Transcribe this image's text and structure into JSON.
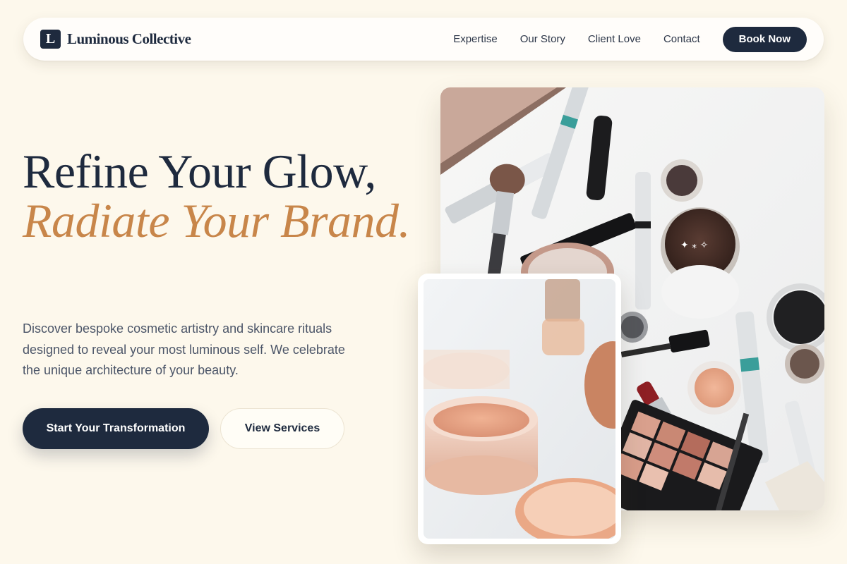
{
  "brand": {
    "mark": "L",
    "name": "Luminous Collective"
  },
  "nav": {
    "links": [
      "Expertise",
      "Our Story",
      "Client Love",
      "Contact"
    ],
    "cta": "Book Now"
  },
  "hero": {
    "headline_line1": "Refine Your Glow,",
    "headline_accent": "Radiate Your Brand.",
    "description": "Discover bespoke cosmetic artistry and skincare rituals designed to reveal your most luminous self. We celebrate the unique architecture of your beauty.",
    "primary_cta": "Start Your Transformation",
    "secondary_cta": "View Services"
  },
  "colors": {
    "page_bg": "#fdf8ec",
    "navy": "#1e2a3e",
    "accent": "#c8864a"
  },
  "images": {
    "main": "flat-lay of makeup products: brushes, mascara, lipstick, eyeshadow palette, pots",
    "inset": "close-up of open jars of peach loose powder"
  }
}
